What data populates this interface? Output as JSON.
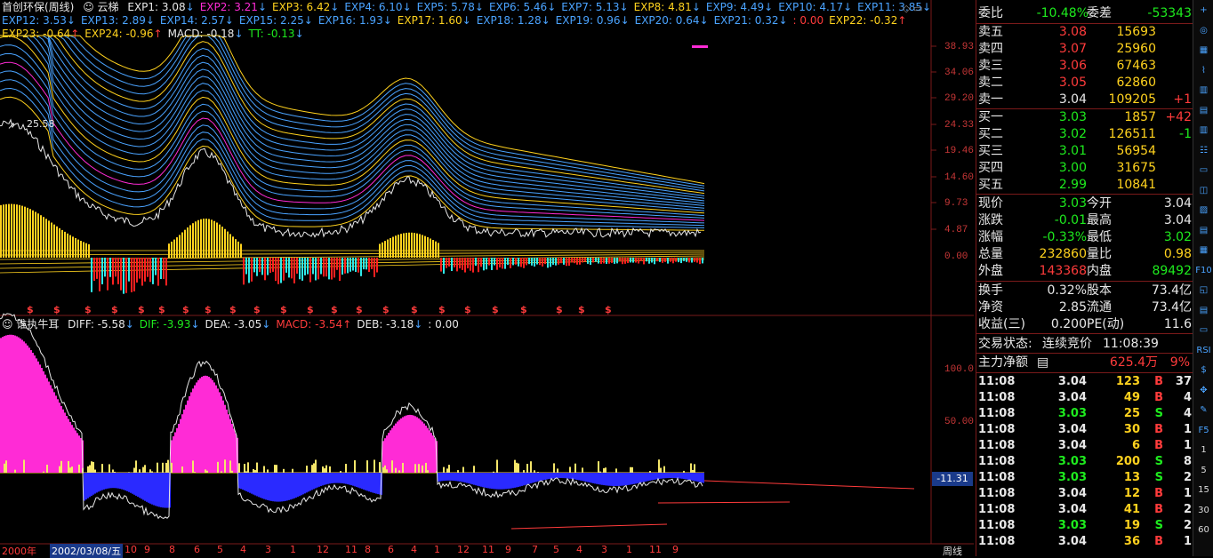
{
  "chart": {
    "title": "首创环保(周线)",
    "indicator_name": "云梯",
    "exp_legend_row1": [
      {
        "label": "EXP1: 3.08",
        "arrow": "↓",
        "color": "#e8e8e8"
      },
      {
        "label": "EXP2: 3.21",
        "arrow": "↓",
        "color": "#ff2bd6"
      },
      {
        "label": "EXP3: 6.42",
        "arrow": "↓",
        "color": "#ffd21e"
      },
      {
        "label": "EXP4: 6.10",
        "arrow": "↓",
        "color": "#4aa3ff"
      },
      {
        "label": "EXP5: 5.78",
        "arrow": "↓",
        "color": "#4aa3ff"
      },
      {
        "label": "EXP6: 5.46",
        "arrow": "↓",
        "color": "#4aa3ff"
      },
      {
        "label": "EXP7: 5.13",
        "arrow": "↓",
        "color": "#4aa3ff"
      },
      {
        "label": "EXP8: 4.81",
        "arrow": "↓",
        "color": "#ffd21e"
      },
      {
        "label": "EXP9: 4.49",
        "arrow": "↓",
        "color": "#4aa3ff"
      },
      {
        "label": "EXP10: 4.17",
        "arrow": "↓",
        "color": "#4aa3ff"
      },
      {
        "label": "EXP11: 3.85",
        "arrow": "↓",
        "color": "#4aa3ff"
      }
    ],
    "exp_legend_row2": [
      {
        "label": "EXP12: 3.53",
        "arrow": "↓",
        "color": "#4aa3ff"
      },
      {
        "label": "EXP13: 2.89",
        "arrow": "↓",
        "color": "#4aa3ff"
      },
      {
        "label": "EXP14: 2.57",
        "arrow": "↓",
        "color": "#4aa3ff"
      },
      {
        "label": "EXP15: 2.25",
        "arrow": "↓",
        "color": "#4aa3ff"
      },
      {
        "label": "EXP16: 1.93",
        "arrow": "↓",
        "color": "#4aa3ff"
      },
      {
        "label": "EXP17: 1.60",
        "arrow": "↓",
        "color": "#ffd21e"
      },
      {
        "label": "EXP18: 1.28",
        "arrow": "↓",
        "color": "#4aa3ff"
      },
      {
        "label": "EXP19: 0.96",
        "arrow": "↓",
        "color": "#4aa3ff"
      },
      {
        "label": "EXP20: 0.64",
        "arrow": "↓",
        "color": "#4aa3ff"
      },
      {
        "label": "EXP21: 0.32",
        "arrow": "↓",
        "color": "#4aa3ff"
      },
      {
        "label": ": 0.00",
        "arrow": "",
        "color": "#ff3b3b"
      },
      {
        "label": "EXP22: -0.32",
        "arrow": "↑",
        "color": "#ffd21e"
      }
    ],
    "exp_legend_row3": [
      {
        "label": "EXP23: -0.64",
        "arrow": "↑",
        "color": "#ffd21e"
      },
      {
        "label": "EXP24: -0.96",
        "arrow": "↑",
        "color": "#ffd21e"
      },
      {
        "label": "MACD: -0.18",
        "arrow": "↓",
        "color": "#e8e8e8"
      },
      {
        "label": "TT: -0.13",
        "arrow": "↓",
        "color": "#1eeb1e"
      }
    ],
    "price_axis": [
      "38.93",
      "34.06",
      "29.20",
      "24.33",
      "19.46",
      "14.60",
      "9.73",
      "4.87",
      "0.00"
    ],
    "peak_label": "25.58",
    "sub_indicator_name": "谁执牛耳",
    "sub_legend": [
      {
        "label": "DIFF: -5.58",
        "arrow": "↓",
        "color": "#e8e8e8"
      },
      {
        "label": "DIF: -3.93",
        "arrow": "↓",
        "color": "#1eeb1e"
      },
      {
        "label": "DEA: -3.05",
        "arrow": "↓",
        "color": "#e8e8e8"
      },
      {
        "label": "MACD: -3.54",
        "arrow": "↑",
        "color": "#ff3b3b"
      },
      {
        "label": "DEB: -3.18",
        "arrow": "↓",
        "color": "#e8e8e8"
      },
      {
        "label": ": 0.00",
        "arrow": "",
        "color": "#e8e8e8"
      }
    ],
    "sub_axis": [
      "100.0",
      "50.00"
    ],
    "sub_current": "-11.31",
    "time_axis": [
      "2000年",
      "2002/03/08/五",
      "10",
      "9",
      "8",
      "6",
      "5",
      "4",
      "3",
      "1",
      "12",
      "11",
      "8",
      "6",
      "4",
      "1",
      "12",
      "11",
      "9",
      "7",
      "5",
      "4",
      "3",
      "1",
      "11",
      "9"
    ],
    "time_axis_end": "周线",
    "dollar_marks": 23
  },
  "quote": {
    "weibi_label": "委比",
    "weibi_val": "-10.48%",
    "weicha_label": "委差",
    "weicha_val": "-53343",
    "asks": [
      {
        "label": "卖五",
        "price": "3.08",
        "vol": "15693",
        "chg": ""
      },
      {
        "label": "卖四",
        "price": "3.07",
        "vol": "25960",
        "chg": ""
      },
      {
        "label": "卖三",
        "price": "3.06",
        "vol": "67463",
        "chg": ""
      },
      {
        "label": "卖二",
        "price": "3.05",
        "vol": "62860",
        "chg": ""
      },
      {
        "label": "卖一",
        "price": "3.04",
        "vol": "109205",
        "chg": "+1"
      }
    ],
    "bids": [
      {
        "label": "买一",
        "price": "3.03",
        "vol": "1857",
        "chg": "+42"
      },
      {
        "label": "买二",
        "price": "3.02",
        "vol": "126511",
        "chg": "-1"
      },
      {
        "label": "买三",
        "price": "3.01",
        "vol": "56954",
        "chg": ""
      },
      {
        "label": "买四",
        "price": "3.00",
        "vol": "31675",
        "chg": ""
      },
      {
        "label": "买五",
        "price": "2.99",
        "vol": "10841",
        "chg": ""
      }
    ],
    "stats": [
      {
        "l1": "现价",
        "v1": "3.03",
        "c1": "green",
        "l2": "今开",
        "v2": "3.04",
        "c2": "white"
      },
      {
        "l1": "涨跌",
        "v1": "-0.01",
        "c1": "green",
        "l2": "最高",
        "v2": "3.04",
        "c2": "white"
      },
      {
        "l1": "涨幅",
        "v1": "-0.33%",
        "c1": "green",
        "l2": "最低",
        "v2": "3.02",
        "c2": "green"
      },
      {
        "l1": "总量",
        "v1": "232860",
        "c1": "yellow",
        "l2": "量比",
        "v2": "0.98",
        "c2": "yellow"
      },
      {
        "l1": "外盘",
        "v1": "143368",
        "c1": "red",
        "l2": "内盘",
        "v2": "89492",
        "c2": "green"
      }
    ],
    "stats2": [
      {
        "l1": "换手",
        "v1": "0.32%",
        "c1": "white",
        "l2": "股本",
        "v2": "73.4亿",
        "c2": "white"
      },
      {
        "l1": "净资",
        "v1": "2.85",
        "c1": "white",
        "l2": "流通",
        "v2": "73.4亿",
        "c2": "white"
      },
      {
        "l1": "收益(三)",
        "v1": "0.200",
        "c1": "white",
        "l2": "PE(动)",
        "v2": "11.6",
        "c2": "white"
      }
    ],
    "trade_status_label": "交易状态:",
    "trade_status": "连续竞价",
    "trade_time": "11:08:39",
    "main_flow_label": "主力净额",
    "main_flow_val": "625.4万",
    "main_flow_pct": "9%",
    "ticks": [
      {
        "t": "11:08",
        "p": "3.04",
        "pc": "white",
        "v": "123",
        "d": "B",
        "n": "37"
      },
      {
        "t": "11:08",
        "p": "3.04",
        "pc": "white",
        "v": "49",
        "d": "B",
        "n": "4"
      },
      {
        "t": "11:08",
        "p": "3.03",
        "pc": "green",
        "v": "25",
        "d": "S",
        "n": "4"
      },
      {
        "t": "11:08",
        "p": "3.04",
        "pc": "white",
        "v": "30",
        "d": "B",
        "n": "1"
      },
      {
        "t": "11:08",
        "p": "3.04",
        "pc": "white",
        "v": "6",
        "d": "B",
        "n": "1"
      },
      {
        "t": "11:08",
        "p": "3.03",
        "pc": "green",
        "v": "200",
        "d": "S",
        "n": "8"
      },
      {
        "t": "11:08",
        "p": "3.03",
        "pc": "green",
        "v": "13",
        "d": "S",
        "n": "2"
      },
      {
        "t": "11:08",
        "p": "3.04",
        "pc": "white",
        "v": "12",
        "d": "B",
        "n": "1"
      },
      {
        "t": "11:08",
        "p": "3.04",
        "pc": "white",
        "v": "41",
        "d": "B",
        "n": "2"
      },
      {
        "t": "11:08",
        "p": "3.03",
        "pc": "green",
        "v": "19",
        "d": "S",
        "n": "2"
      },
      {
        "t": "11:08",
        "p": "3.04",
        "pc": "white",
        "v": "36",
        "d": "B",
        "n": "1"
      }
    ]
  },
  "toolbar": [
    "+",
    "◎",
    "▦",
    "⌇",
    "▥",
    "▤",
    "▥",
    "☷",
    "▭",
    "◫",
    "▨",
    "▤",
    "▦",
    "F10",
    "◱",
    "▤",
    "▭",
    "RSI",
    "$",
    "✥",
    "✎",
    "F5",
    "1",
    "5",
    "15",
    "30",
    "60"
  ]
}
